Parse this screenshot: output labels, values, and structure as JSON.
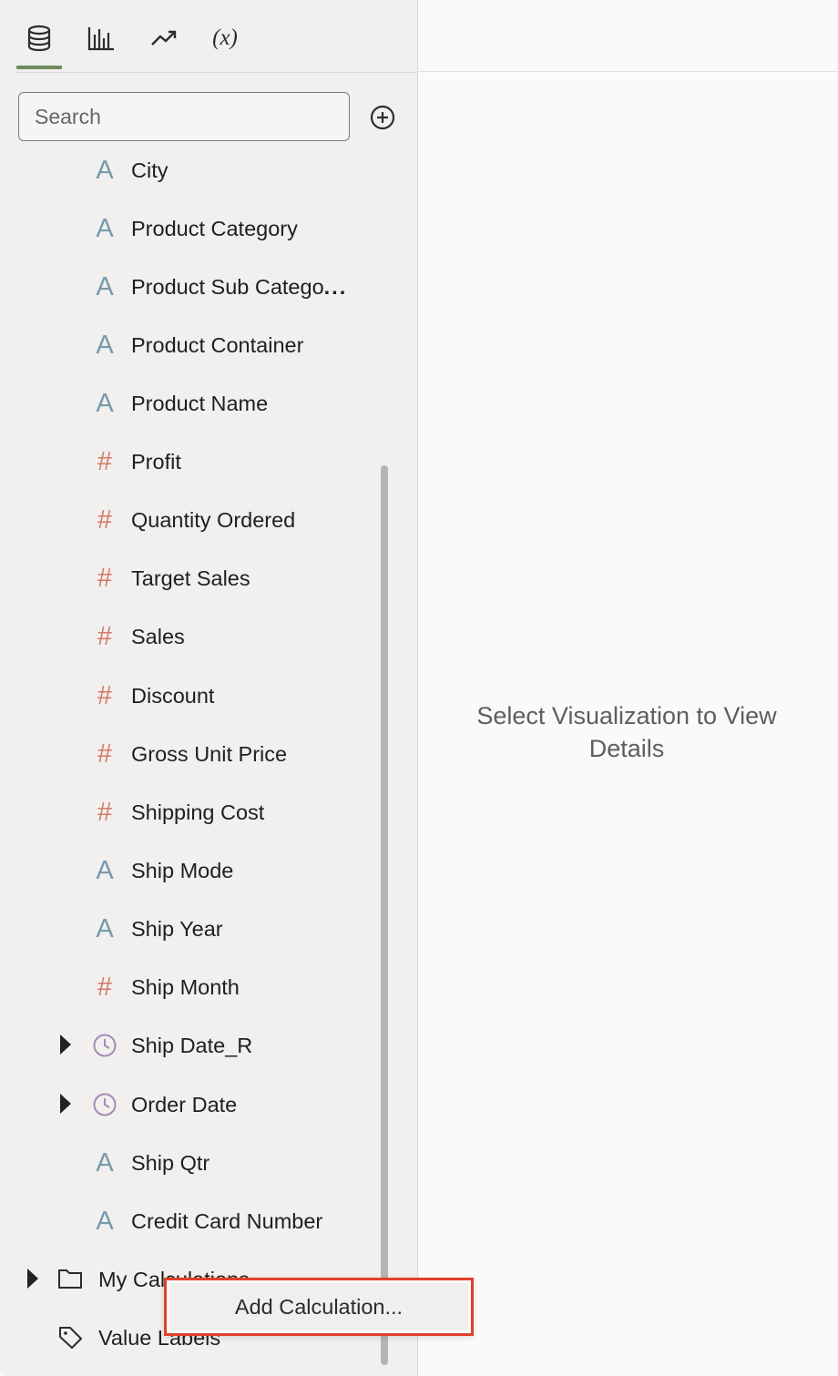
{
  "toolbar": {
    "tabs": [
      {
        "name": "data",
        "icon": "database-icon",
        "active": true
      },
      {
        "name": "visualizations",
        "icon": "bar-chart-icon",
        "active": false
      },
      {
        "name": "analytics",
        "icon": "trend-line-icon",
        "active": false
      },
      {
        "name": "parameters",
        "icon": "fx-icon",
        "label": "(x)",
        "active": false
      }
    ]
  },
  "search": {
    "placeholder": "Search",
    "value": ""
  },
  "fields": [
    {
      "label": "City",
      "type": "attribute",
      "icon": "text-attribute-icon"
    },
    {
      "label": "Product Category",
      "type": "attribute",
      "icon": "text-attribute-icon"
    },
    {
      "label": "Product Sub Catego",
      "label_suffix": "...",
      "type": "attribute",
      "icon": "text-attribute-icon"
    },
    {
      "label": "Product Container",
      "type": "attribute",
      "icon": "text-attribute-icon"
    },
    {
      "label": "Product Name",
      "type": "attribute",
      "icon": "text-attribute-icon"
    },
    {
      "label": "Profit",
      "type": "measure",
      "icon": "hash-measure-icon"
    },
    {
      "label": "Quantity Ordered",
      "type": "measure",
      "icon": "hash-measure-icon"
    },
    {
      "label": "Target Sales",
      "type": "measure",
      "icon": "hash-measure-icon"
    },
    {
      "label": "Sales",
      "type": "measure",
      "icon": "hash-measure-icon"
    },
    {
      "label": "Discount",
      "type": "measure",
      "icon": "hash-measure-icon"
    },
    {
      "label": "Gross Unit Price",
      "type": "measure",
      "icon": "hash-measure-icon"
    },
    {
      "label": "Shipping Cost",
      "type": "measure",
      "icon": "hash-measure-icon"
    },
    {
      "label": "Ship Mode",
      "type": "attribute",
      "icon": "text-attribute-icon"
    },
    {
      "label": "Ship Year",
      "type": "attribute",
      "icon": "text-attribute-icon"
    },
    {
      "label": "Ship Month",
      "type": "measure",
      "icon": "hash-measure-icon"
    },
    {
      "label": "Ship Date_R",
      "type": "time",
      "icon": "clock-icon",
      "expandable": true
    },
    {
      "label": "Order Date",
      "type": "time",
      "icon": "clock-icon",
      "expandable": true
    },
    {
      "label": "Ship Qtr",
      "type": "attribute",
      "icon": "text-attribute-icon"
    },
    {
      "label": "Credit Card Number",
      "type": "attribute",
      "icon": "text-attribute-icon"
    }
  ],
  "folders": [
    {
      "label": "My Calculations",
      "icon": "folder-icon",
      "expandable": true
    },
    {
      "label": "Value Labels",
      "icon": "tag-icon",
      "expandable": false
    }
  ],
  "right_panel": {
    "message": "Select Visualization to View Details"
  },
  "context_menu": {
    "items": [
      {
        "label": "Add Calculation..."
      }
    ]
  },
  "colors": {
    "attribute_icon": "#7899ac",
    "measure_icon": "#d5786a",
    "time_icon": "#a48bb8",
    "active_tab": "#6e8b5d",
    "menu_highlight_border": "#e2402a"
  }
}
